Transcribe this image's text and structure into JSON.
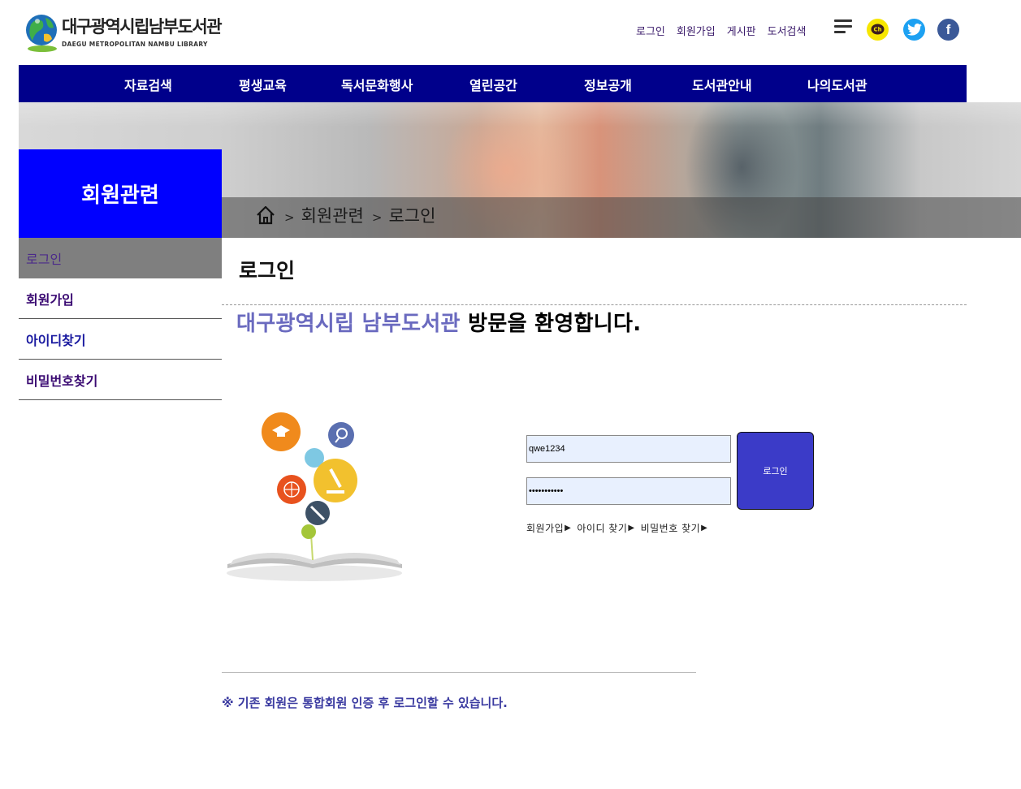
{
  "header": {
    "logo_kr": "대구광역시립남부도서관",
    "logo_en": "DAEGU METROPOLITAN NAMBU LIBRARY",
    "top_links": [
      "로그인",
      "회원가입",
      "게시판",
      "도서검색"
    ],
    "social": {
      "kakao_label": "Ch",
      "facebook_label": "f"
    }
  },
  "nav": [
    "자료검색",
    "평생교육",
    "독서문화행사",
    "열린공간",
    "정보공개",
    "도서관안내",
    "나의도서관"
  ],
  "breadcrumb": {
    "sep1": ">",
    "crumb1": "회원관련",
    "sep2": ">",
    "crumb2": "로그인"
  },
  "sidebar": {
    "title": "회원관련",
    "items": [
      {
        "label": "로그인"
      },
      {
        "label": "회원가입"
      },
      {
        "label": "아이디찾기"
      },
      {
        "label": "비밀번호찾기"
      }
    ]
  },
  "content": {
    "title": "로그인",
    "welcome_lib": "대구광역시립 남부도서관",
    "welcome_rest": " 방문을 환영합니다.",
    "login": {
      "id_value": "qwe1234",
      "pw_value": "•••••••••••",
      "button": "로그인",
      "links": [
        "회원가입",
        "아이디 찾기",
        "비밀번호 찾기"
      ],
      "arrow": "▶"
    },
    "notice": "※ 기존 회원은 통합회원 인증 후 로그인할 수 있습니다."
  },
  "colors": {
    "nav_bg": "#00008b",
    "sidebar_title_bg": "#0000ff",
    "login_button": "#3b3bc8",
    "welcome_accent": "#6a6abf"
  }
}
